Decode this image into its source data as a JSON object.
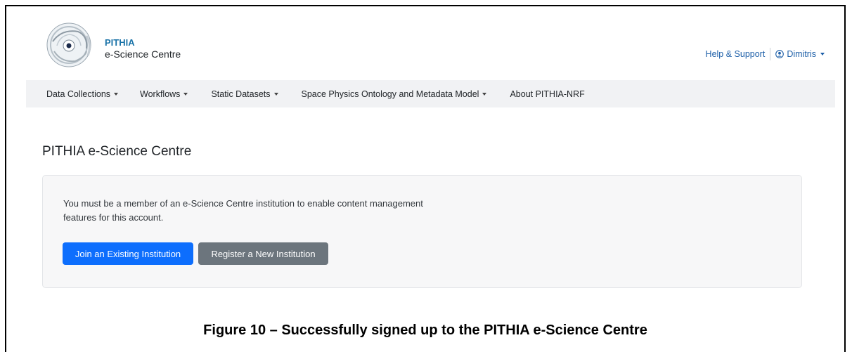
{
  "brand": {
    "line1": "PITHIA",
    "line2": "e-Science Centre",
    "logo_text": "PITHIA-NRF"
  },
  "header_links": {
    "help": "Help & Support",
    "user": "Dimitris"
  },
  "nav": {
    "items": [
      {
        "label": "Data Collections",
        "dropdown": true
      },
      {
        "label": "Workflows",
        "dropdown": true
      },
      {
        "label": "Static Datasets",
        "dropdown": true
      },
      {
        "label": "Space Physics Ontology and Metadata Model",
        "dropdown": true
      },
      {
        "label": "About PITHIA-NRF",
        "dropdown": false
      }
    ]
  },
  "main": {
    "title": "PITHIA e-Science Centre",
    "message_line1": "You must be a member of an e-Science Centre institution to enable content management",
    "message_line2": "features for this account.",
    "join_button": "Join an Existing Institution",
    "register_button": "Register a New Institution"
  },
  "caption": "Figure 10 – Successfully signed up to the PITHIA e-Science Centre",
  "colors": {
    "primary": "#0d6efd",
    "secondary": "#6c757d",
    "link": "#1d5fa8",
    "brand": "#1a73a8",
    "nav_bg": "#f1f2f4"
  }
}
